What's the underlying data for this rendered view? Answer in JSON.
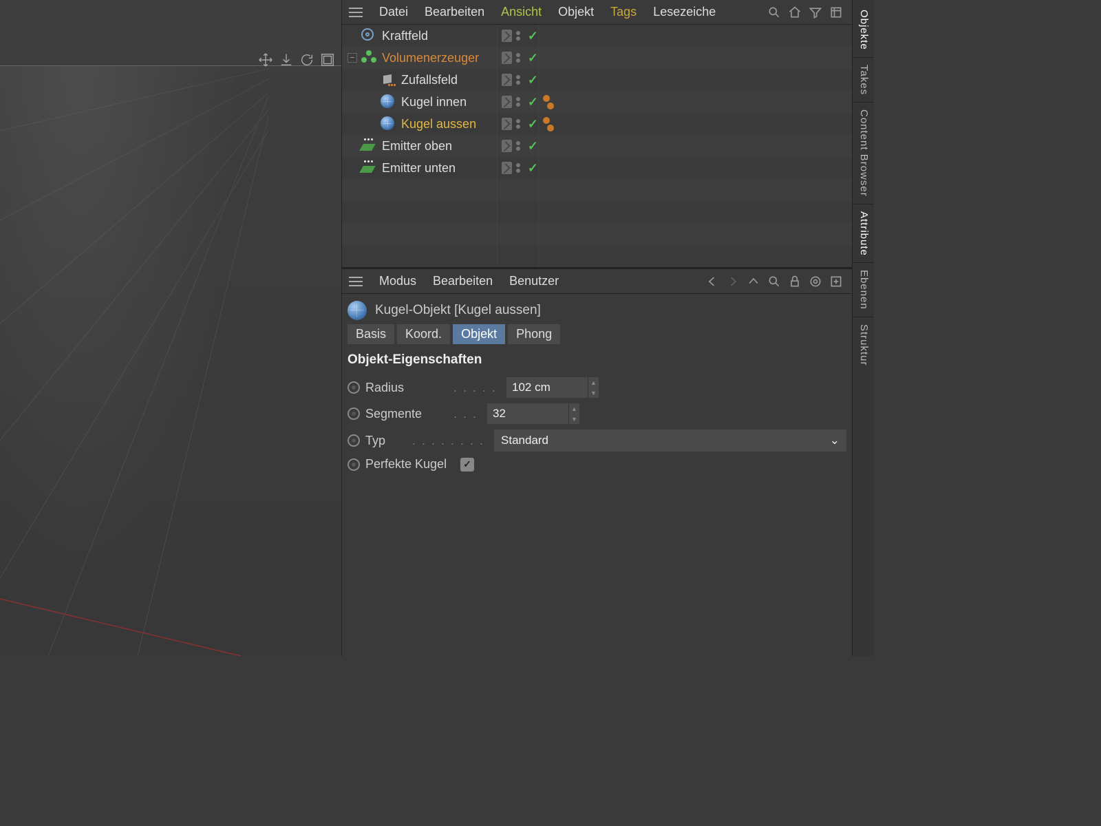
{
  "viewport": {},
  "right_tabs": {
    "objekte": "Objekte",
    "takes": "Takes",
    "content": "Content Browser",
    "attribute": "Attribute",
    "ebenen": "Ebenen",
    "struktur": "Struktur"
  },
  "object_manager": {
    "menu": {
      "datei": "Datei",
      "bearbeiten": "Bearbeiten",
      "ansicht": "Ansicht",
      "objekt": "Objekt",
      "tags": "Tags",
      "lesezeiche": "Lesezeiche"
    },
    "tree": [
      {
        "name": "Kraftfeld",
        "icon": "field",
        "indent": 0,
        "expander": null,
        "hl": null,
        "extra_tags": false
      },
      {
        "name": "Volumenerzeuger",
        "icon": "volume",
        "indent": 0,
        "expander": "minus",
        "hl": "orange",
        "extra_tags": false
      },
      {
        "name": "Zufallsfeld",
        "icon": "random",
        "indent": 1,
        "expander": null,
        "hl": null,
        "extra_tags": false
      },
      {
        "name": "Kugel innen",
        "icon": "sphere",
        "indent": 1,
        "expander": null,
        "hl": null,
        "extra_tags": true
      },
      {
        "name": "Kugel aussen",
        "icon": "sphere",
        "indent": 1,
        "expander": null,
        "hl": "yellow",
        "extra_tags": true
      },
      {
        "name": "Emitter oben",
        "icon": "emitter",
        "indent": 0,
        "expander": null,
        "hl": null,
        "extra_tags": false
      },
      {
        "name": "Emitter unten",
        "icon": "emitter",
        "indent": 0,
        "expander": null,
        "hl": null,
        "extra_tags": false
      }
    ]
  },
  "attribute_manager": {
    "menu": {
      "modus": "Modus",
      "bearbeiten": "Bearbeiten",
      "benutzer": "Benutzer"
    },
    "header": "Kugel-Objekt [Kugel aussen]",
    "tabs": {
      "basis": "Basis",
      "koord": "Koord.",
      "objekt": "Objekt",
      "phong": "Phong"
    },
    "active_tab": "objekt",
    "section_title": "Objekt-Eigenschaften",
    "props": {
      "radius_label": "Radius",
      "radius_value": "102 cm",
      "segmente_label": "Segmente",
      "segmente_value": "32",
      "typ_label": "Typ",
      "typ_value": "Standard",
      "perfekte_label": "Perfekte Kugel",
      "perfekte_checked": true
    }
  }
}
